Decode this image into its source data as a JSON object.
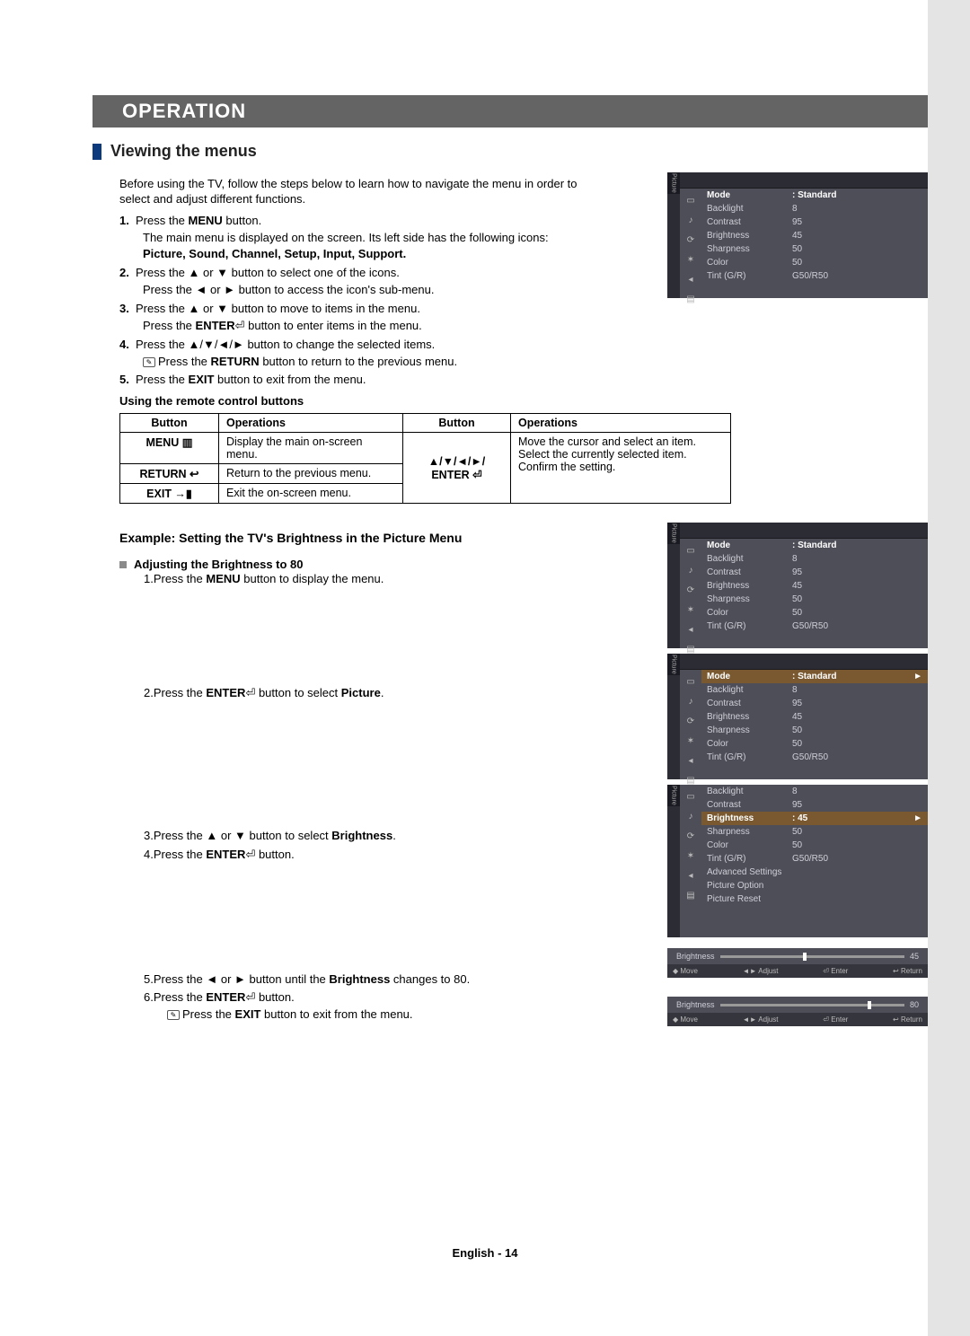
{
  "header": "OPERATION",
  "section_title": "Viewing the menus",
  "intro": "Before using the TV, follow the steps below to learn how to navigate the menu in order to select and adjust different functions.",
  "step1_a": "Press the ",
  "step1_b": "MENU",
  "step1_c": " button.",
  "step1_sub_a": "The main menu is displayed on the screen. Its left side has the following icons: ",
  "step1_sub_b": "Picture, Sound, Channel, Setup, Input, Support.",
  "step2_a": "Press the ▲ or ▼ button to select one of the icons.",
  "step2_b": "Press the ◄ or ► button to access the icon's sub-menu.",
  "step3_a": "Press the ▲ or ▼ button to move to items in the menu.",
  "step3_b_a": "Press the ",
  "step3_b_b": "ENTER",
  "step3_b_c": " button to enter items in the menu.",
  "step4_a": "Press the ▲/▼/◄/► button to change the selected items.",
  "step4_b_a": "Press the ",
  "step4_b_b": "RETURN",
  "step4_b_c": " button to return to the previous menu.",
  "step5_a": "Press the ",
  "step5_b": "EXIT",
  "step5_c": " button to exit from the menu.",
  "using_remote": "Using the remote control buttons",
  "table": {
    "h1": "Button",
    "h2": "Operations",
    "h3": "Button",
    "h4": "Operations",
    "r1c1": "MENU ▥",
    "r1c2": "Display the main on-screen menu.",
    "r2c1": "RETURN ↩",
    "r2c2": "Return to the previous menu.",
    "r3c1": "EXIT →▮",
    "r3c2": "Exit the on-screen menu.",
    "rc3_line1": "▲/▼/◄/►/",
    "rc3_line2": "ENTER ⏎",
    "rc4_1": "Move the cursor and select an item.",
    "rc4_2": "Select the currently selected item.",
    "rc4_3": "Confirm the setting."
  },
  "example_head": "Example: Setting the TV's Brightness in the Picture Menu",
  "adjust_head": "Adjusting the Brightness to 80",
  "s2_1_a": "Press the ",
  "s2_1_b": "MENU",
  "s2_1_c": " button to display the menu.",
  "s2_2_a": "Press the ",
  "s2_2_b": "ENTER",
  "s2_2_c": " button to select ",
  "s2_2_d": "Picture",
  "s2_2_e": ".",
  "s2_3_a": "Press the ▲ or ▼ button to select ",
  "s2_3_b": "Brightness",
  "s2_3_c": ".",
  "s2_4_a": "Press the ",
  "s2_4_b": "ENTER",
  "s2_4_c": " button.",
  "s2_5_a": "Press the ◄ or ► button until the ",
  "s2_5_b": "Brightness",
  "s2_5_c": " changes to 80.",
  "s2_6_a": "Press the ",
  "s2_6_b": "ENTER",
  "s2_6_c": " button.",
  "s2_6_note_a": "Press the ",
  "s2_6_note_b": "EXIT",
  "s2_6_note_c": " button to exit from the menu.",
  "osd": {
    "side_label": "Picture",
    "mode_lbl": "Mode",
    "mode_val": ": Standard",
    "backlight_lbl": "Backlight",
    "backlight_val": "8",
    "contrast_lbl": "Contrast",
    "contrast_val": "95",
    "brightness_lbl": "Brightness",
    "brightness_val": "45",
    "sharpness_lbl": "Sharpness",
    "sharpness_val": "50",
    "color_lbl": "Color",
    "color_val": "50",
    "tint_lbl": "Tint (G/R)",
    "tint_val": "G50/R50",
    "adv_lbl": "Advanced Settings",
    "popt_lbl": "Picture Option",
    "preset_lbl": "Picture Reset",
    "brightness_sel": ": 45"
  },
  "slider": {
    "label": "Brightness",
    "val45": "45",
    "val80": "80",
    "move": "◆ Move",
    "adjust": "◄► Adjust",
    "enter": "⏎ Enter",
    "return": "↩ Return"
  },
  "footer": "English - 14"
}
